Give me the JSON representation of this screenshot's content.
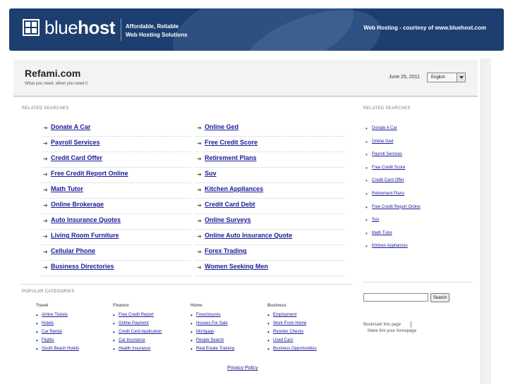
{
  "header": {
    "logo_light": "blue",
    "logo_bold": "host",
    "tagline_line1": "Affordable, Reliable",
    "tagline_line2": "Web Hosting Solutions",
    "courtesy": "Web Hosting - courtesy of www.bluehost.com"
  },
  "site": {
    "title": "Refami.com",
    "subtitle": "What you need, when you need it",
    "date": "June 25, 2011",
    "language": "English"
  },
  "related": {
    "label": "RELATED SEARCHES",
    "left": [
      "Donate A Car",
      "Payroll Services",
      "Credit Card Offer",
      "Free Credit Report Online",
      "Math Tutor",
      "Online Brokerage",
      "Auto Insurance Quotes",
      "Living Room Furniture",
      "Cellular Phone",
      "Business Directories"
    ],
    "right": [
      "Online Ged",
      "Free Credit Score",
      "Retirement Plans",
      "Suv",
      "Kitchen Appliances",
      "Credit Card Debt",
      "Online Surveys",
      "Online Auto Insurance Quote",
      "Forex Trading",
      "Women Seeking Men"
    ]
  },
  "sidebar": {
    "label": "RELATED SEARCHES",
    "items": [
      "Donate A Car",
      "Online Ged",
      "Payroll Services",
      "Free Credit Score",
      "Credit Card Offer",
      "Retirement Plans",
      "Free Credit Report Online",
      "Suv",
      "Math Tutor",
      "Kitchen Appliances"
    ],
    "search_button": "Search",
    "bookmark": "Bookmark this page",
    "homepage": "Make this your homepage"
  },
  "popular": {
    "label": "POPULAR CATEGORIES",
    "columns": [
      {
        "heading": "Travel",
        "items": [
          "Airline Tickets",
          "Hotels",
          "Car Rental",
          "Flights",
          "South Beach Hotels"
        ]
      },
      {
        "heading": "Finance",
        "items": [
          "Free Credit Report",
          "Online Payment",
          "Credit Card Application",
          "Car Insurance",
          "Health Insurance"
        ]
      },
      {
        "heading": "Home",
        "items": [
          "Foreclosures",
          "Houses For Sale",
          "Mortgage",
          "People Search",
          "Real Estate Training"
        ]
      },
      {
        "heading": "Business",
        "items": [
          "Employment",
          "Work From Home",
          "Reorder Checks",
          "Used Cars",
          "Business Opportunities"
        ]
      }
    ]
  },
  "footer": {
    "privacy": "Privacy Policy"
  }
}
